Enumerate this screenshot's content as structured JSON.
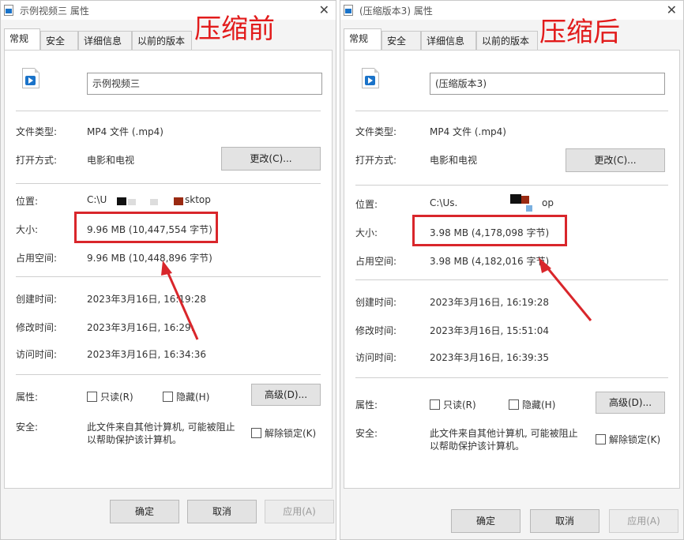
{
  "colors": {
    "annotation_red": "#e21b1b",
    "play_blue": "#1a73c9"
  },
  "left": {
    "title": "示例视频三 属性",
    "overlay_label": "压缩前",
    "tabs": [
      "常规",
      "安全",
      "详细信息",
      "以前的版本"
    ],
    "file_name": "示例视频三",
    "type_label": "文件类型:",
    "type_value": "MP4 文件 (.mp4)",
    "open_label": "打开方式:",
    "open_value": "电影和电视",
    "change_button": "更改(C)...",
    "location_label": "位置:",
    "location_value_start": "C:\\U",
    "location_value_end": "sktop",
    "size_label": "大小:",
    "size_value": "9.96 MB (10,447,554 字节)",
    "disk_label": "占用空间:",
    "disk_value": "9.96 MB (10,448,896 字节)",
    "created_label": "创建时间:",
    "created_value": "2023年3月16日, 16:19:28",
    "modified_label": "修改时间:",
    "modified_value": "2023年3月16日, 16:29:",
    "accessed_label": "访问时间:",
    "accessed_value": "2023年3月16日, 16:34:36",
    "attr_label": "属性:",
    "readonly_label": "只读(R)",
    "hidden_label": "隐藏(H)",
    "advanced_button": "高级(D)...",
    "security_label": "安全:",
    "security_text_line1": "此文件来自其他计算机, 可能被阻止",
    "security_text_line2": "以帮助保护该计算机。",
    "unblock_label": "解除锁定(K)",
    "ok": "确定",
    "cancel": "取消",
    "apply": "应用(A)"
  },
  "right": {
    "title": "(压缩版本3) 属性",
    "overlay_label": "压缩后",
    "tabs": [
      "常规",
      "安全",
      "详细信息",
      "以前的版本"
    ],
    "file_name": "(压缩版本3)",
    "type_label": "文件类型:",
    "type_value": "MP4 文件 (.mp4)",
    "open_label": "打开方式:",
    "open_value": "电影和电视",
    "change_button": "更改(C)...",
    "location_label": "位置:",
    "location_value_start": "C:\\Us.",
    "location_value_end": "op",
    "size_label": "大小:",
    "size_value": "3.98 MB (4,178,098 字节)",
    "disk_label": "占用空间:",
    "disk_value": "3.98 MB (4,182,016 字节)",
    "created_label": "创建时间:",
    "created_value": "2023年3月16日, 16:19:28",
    "modified_label": "修改时间:",
    "modified_value": "2023年3月16日, 15:51:04",
    "accessed_label": "访问时间:",
    "accessed_value": "2023年3月16日, 16:39:35",
    "attr_label": "属性:",
    "readonly_label": "只读(R)",
    "hidden_label": "隐藏(H)",
    "advanced_button": "高级(D)...",
    "security_label": "安全:",
    "security_text_line1": "此文件来自其他计算机, 可能被阻止",
    "security_text_line2": "以帮助保护该计算机。",
    "unblock_label": "解除锁定(K)",
    "ok": "确定",
    "cancel": "取消",
    "apply": "应用(A)"
  }
}
